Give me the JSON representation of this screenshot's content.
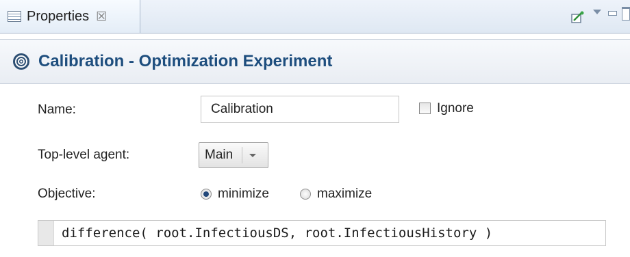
{
  "tab": {
    "label": "Properties",
    "close_glyph": "☒",
    "icon": "properties-icon"
  },
  "toolbar": {
    "icons": [
      "pin-icon",
      "view-menu-icon",
      "minimize-icon",
      "maximize-icon"
    ]
  },
  "header": {
    "title": "Calibration - Optimization Experiment",
    "icon": "experiment-icon",
    "title_color": "#1e4e7e"
  },
  "form": {
    "name_label": "Name:",
    "name_value": "Calibration",
    "ignore_label": "Ignore",
    "ignore_checked": false,
    "agent_label": "Top-level agent:",
    "agent_value": "Main",
    "objective_label": "Objective:",
    "objective_options": [
      "minimize",
      "maximize"
    ],
    "objective_selected": "minimize",
    "objective_expression": "difference( root.InfectiousDS, root.InfectiousHistory )"
  }
}
